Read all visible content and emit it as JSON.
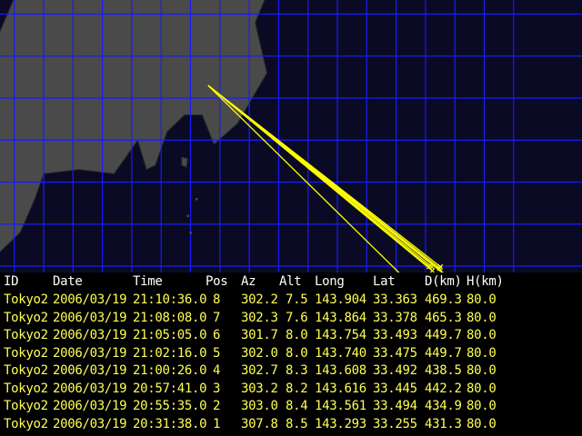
{
  "colors": {
    "background": "#000000",
    "sea": "#0a0a24",
    "land": "#4a4a4a",
    "land_shadow": "#2a2a2a",
    "grid": "#1a1aff",
    "track": "#ffff00",
    "header_text": "#ffffff",
    "row_text": "#ffff55"
  },
  "map": {
    "grid_step_lon": 0.5,
    "grid_step_lat": 0.5,
    "lon_range": [
      135.0,
      145.0
    ],
    "lat_range": [
      32.0,
      38.5
    ],
    "land_regions": [
      {
        "name": "honshu-kanto-chubu",
        "shape": [
          [
            136.2,
            38.4
          ],
          [
            137.3,
            38.5
          ],
          [
            138.2,
            38.5
          ],
          [
            139.8,
            38.5
          ],
          [
            141.2,
            38.5
          ],
          [
            141.1,
            37.6
          ],
          [
            140.9,
            36.9
          ],
          [
            140.6,
            36.4
          ],
          [
            140.8,
            35.8
          ],
          [
            140.3,
            35.2
          ],
          [
            139.9,
            34.95
          ],
          [
            139.7,
            35.3
          ],
          [
            139.4,
            35.3
          ],
          [
            139.1,
            35.1
          ],
          [
            138.9,
            34.7
          ],
          [
            138.75,
            34.65
          ],
          [
            138.6,
            35.0
          ],
          [
            138.2,
            34.6
          ],
          [
            137.6,
            34.65
          ],
          [
            137.0,
            34.6
          ],
          [
            136.85,
            34.3
          ],
          [
            136.6,
            33.9
          ],
          [
            136.0,
            33.5
          ],
          [
            135.4,
            33.6
          ],
          [
            135.05,
            34.2
          ],
          [
            135.0,
            35.0
          ],
          [
            135.3,
            35.5
          ],
          [
            135.8,
            35.5
          ],
          [
            136.2,
            36.2
          ],
          [
            136.75,
            37.1
          ],
          [
            137.0,
            37.4
          ],
          [
            136.6,
            37.4
          ],
          [
            136.4,
            37.8
          ]
        ]
      },
      {
        "name": "sado-island",
        "shape": [
          [
            138.25,
            38.05
          ],
          [
            138.55,
            38.3
          ],
          [
            138.5,
            37.85
          ],
          [
            138.25,
            37.9
          ]
        ]
      },
      {
        "name": "shikoku",
        "shape": [
          [
            135.0,
            34.3
          ],
          [
            134.7,
            34.2
          ],
          [
            134.6,
            33.9
          ],
          [
            134.8,
            33.7
          ],
          [
            135.0,
            33.8
          ]
        ]
      },
      {
        "name": "izu-islands-north",
        "shape": [
          [
            139.35,
            34.8
          ],
          [
            139.45,
            34.78
          ],
          [
            139.43,
            34.68
          ],
          [
            139.35,
            34.7
          ]
        ]
      }
    ],
    "markers": [
      {
        "name": "izu-island-dot",
        "lon": 139.6,
        "lat": 34.3
      },
      {
        "name": "izu-island-dot",
        "lon": 139.45,
        "lat": 34.1
      },
      {
        "name": "izu-island-dot",
        "lon": 139.5,
        "lat": 33.9
      },
      {
        "name": "izu-island-dot",
        "lon": 139.75,
        "lat": 33.2
      }
    ],
    "tracks_origin": {
      "lon": 139.8,
      "lat": 35.65
    }
  },
  "table": {
    "columns": [
      "ID",
      "Date",
      "Time",
      "Pos",
      "Az",
      "Alt",
      "Long",
      "Lat",
      "D(km)",
      "H(km)"
    ],
    "rows": [
      [
        "Tokyo2",
        "2006/03/19",
        "21:10:36.0",
        "8",
        "302.2",
        "7.5",
        "143.904",
        "33.363",
        "469.3",
        "80.0"
      ],
      [
        "Tokyo2",
        "2006/03/19",
        "21:08:08.0",
        "7",
        "302.3",
        "7.6",
        "143.864",
        "33.378",
        "465.3",
        "80.0"
      ],
      [
        "Tokyo2",
        "2006/03/19",
        "21:05:05.0",
        "6",
        "301.7",
        "8.0",
        "143.754",
        "33.493",
        "449.7",
        "80.0"
      ],
      [
        "Tokyo2",
        "2006/03/19",
        "21:02:16.0",
        "5",
        "302.0",
        "8.0",
        "143.740",
        "33.475",
        "449.7",
        "80.0"
      ],
      [
        "Tokyo2",
        "2006/03/19",
        "21:00:26.0",
        "4",
        "302.7",
        "8.3",
        "143.608",
        "33.492",
        "438.5",
        "80.0"
      ],
      [
        "Tokyo2",
        "2006/03/19",
        "20:57:41.0",
        "3",
        "303.2",
        "8.2",
        "143.616",
        "33.445",
        "442.2",
        "80.0"
      ],
      [
        "Tokyo2",
        "2006/03/19",
        "20:55:35.0",
        "2",
        "303.0",
        "8.4",
        "143.561",
        "33.494",
        "434.9",
        "80.0"
      ],
      [
        "Tokyo2",
        "2006/03/19",
        "20:31:38.0",
        "1",
        "307.8",
        "8.5",
        "143.293",
        "33.255",
        "431.3",
        "80.0"
      ]
    ]
  }
}
